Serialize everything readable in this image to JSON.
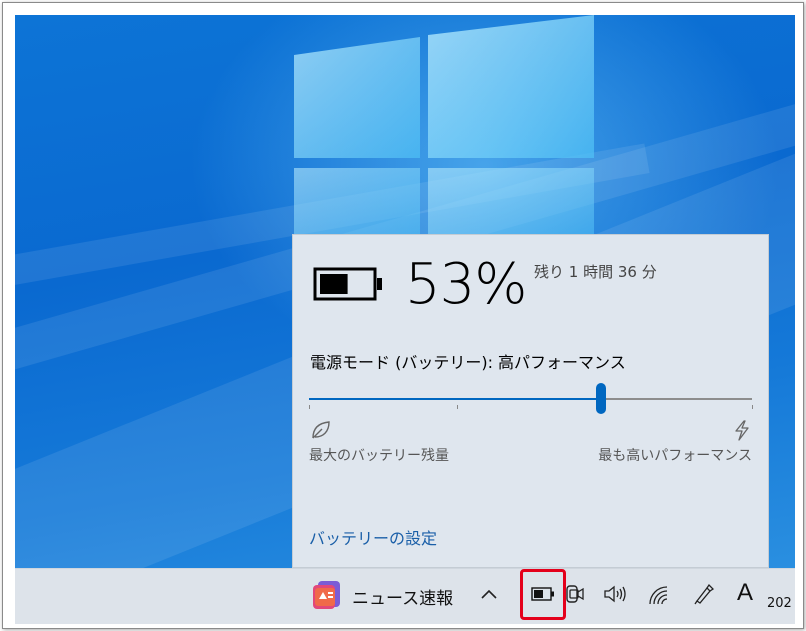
{
  "battery_flyout": {
    "percent": "53%",
    "remaining": "残り 1 時間 36 分",
    "level": 0.53,
    "power_mode_label": "電源モード (バッテリー): 高パフォーマンス",
    "slider_value": 0.66,
    "slider_min_label": "最大のバッテリー残量",
    "slider_max_label": "最も高いパフォーマンス",
    "settings_link": "バッテリーの設定"
  },
  "taskbar": {
    "news_label": "ニュース速報",
    "ime_indicator": "A",
    "clock_partial": "202",
    "icons": [
      "news-icon",
      "chevron-up-icon",
      "battery-icon",
      "meet-now-icon",
      "volume-icon",
      "wifi-icon",
      "pen-icon"
    ]
  },
  "colors": {
    "accent": "#0067c0",
    "highlight": "#e4001b",
    "desktop": "#0a69d0",
    "flyout_bg": "#dfe6ee"
  }
}
